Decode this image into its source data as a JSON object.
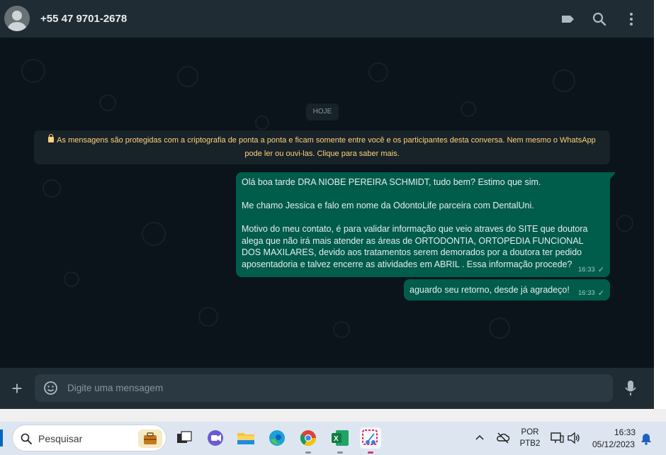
{
  "header": {
    "contact_name": "+55 47 9701-2678",
    "icons": [
      "label-icon",
      "search-icon",
      "more-menu-icon"
    ]
  },
  "chat": {
    "date_chip": "HOJE",
    "encryption_notice": "As mensagens são protegidas com a criptografia de ponta a ponta e ficam somente entre você e os participantes desta conversa. Nem mesmo o WhatsApp pode ler ou ouvi-las. Clique para saber mais.",
    "messages": [
      {
        "text": "Olá boa tarde DRA NIOBE PEREIRA SCHMIDT, tudo bem? Estimo que sim.\n\nMe chamo Jessica e falo em nome da OdontoLife parceira com DentalUni.\n\nMotivo do meu contato, é para validar informação que veio atraves do SITE que doutora alega que não irá mais atender as áreas de ORTODONTIA, ORTOPEDIA FUNCIONAL DOS MAXILARES, devido aos tratamentos serem demorados por a doutora ter pedido aposentadoria e talvez encerre as atividades em ABRIL . Essa informação procede?",
        "time": "16:33",
        "status": "✓"
      },
      {
        "text": "aguardo seu retorno, desde já agradeço!",
        "time": "16:33",
        "status": "✓"
      }
    ]
  },
  "composer": {
    "placeholder": "Digite uma mensagem"
  },
  "taskbar": {
    "search_label": "Pesquisar",
    "language_line1": "POR",
    "language_line2": "PTB2",
    "clock_time": "16:33",
    "clock_date": "05/12/2023"
  },
  "colors": {
    "header_bg": "#202c33",
    "chat_bg": "#0b141a",
    "outgoing_bubble": "#005c4b",
    "notice_text": "#ffd279"
  }
}
